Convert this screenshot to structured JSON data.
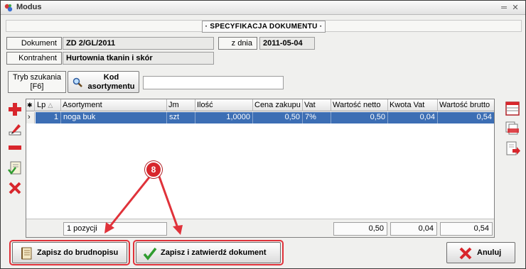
{
  "window": {
    "title": "Modus",
    "controls": [
      "minimize",
      "close"
    ]
  },
  "banner": {
    "title": "· SPECYFIKACJA DOKUMENTU ·"
  },
  "document": {
    "doc_label": "Dokument",
    "doc_value": "ZD 2/GL/2011",
    "date_label": "z dnia",
    "date_value": "2011-05-04",
    "contractor_label": "Kontrahent",
    "contractor_value": "Hurtownia tkanin i skór"
  },
  "search": {
    "mode_label_line1": "Tryb szukania",
    "mode_label_line2": "[F6]",
    "kod_button_line1": "Kod",
    "kod_button_line2": "asortymentu",
    "input_value": ""
  },
  "grid": {
    "columns": [
      "Lp",
      "Asortyment",
      "Jm",
      "Ilość",
      "Cena zakupu",
      "Vat",
      "Wartość netto",
      "Kwota Vat",
      "Wartość brutto"
    ],
    "rows": [
      {
        "lp": "1",
        "asortyment": "noga buk",
        "jm": "szt",
        "ilosc": "1,0000",
        "cena": "0,50",
        "vat": "7%",
        "netto": "0,50",
        "kwota_vat": "0,04",
        "brutto": "0,54"
      }
    ],
    "footer": {
      "count": "1 pozycji",
      "netto_total": "0,50",
      "vat_total": "0,04",
      "brutto_total": "0,54"
    }
  },
  "buttons": {
    "draft_label": "Zapisz do brudnopisu",
    "confirm_label": "Zapisz i zatwierdź dokument",
    "cancel_label": "Anuluj"
  },
  "annotation": {
    "step_number": "8",
    "highlight_color": "#e0323a"
  },
  "colors": {
    "selection": "#3c6eb4",
    "window_bg": "#f0f0ee"
  }
}
